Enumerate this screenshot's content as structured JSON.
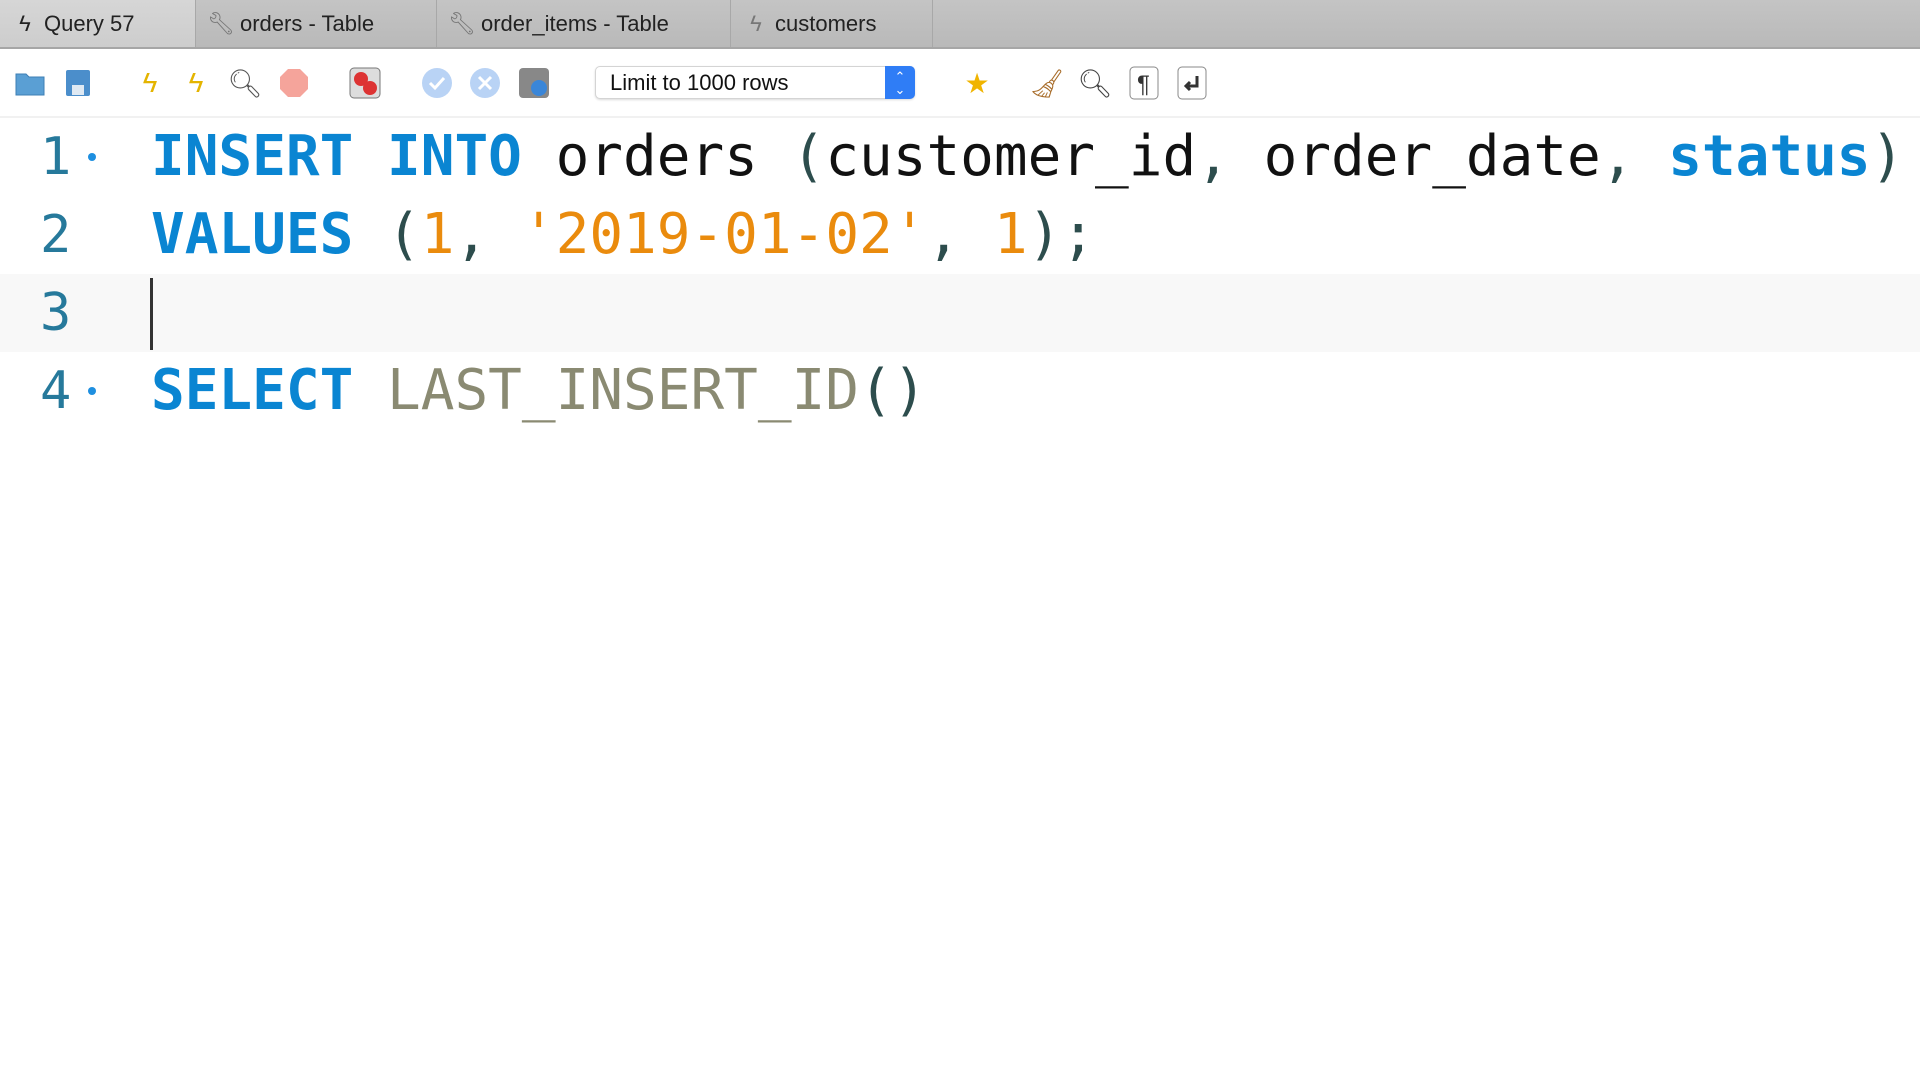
{
  "tabs": [
    {
      "label": "Query 57",
      "icon": "lightning-icon",
      "active": true
    },
    {
      "label": "orders - Table",
      "icon": "wrench-icon"
    },
    {
      "label": "order_items - Table",
      "icon": "wrench-icon"
    },
    {
      "label": "customers",
      "icon": "lightning-icon"
    }
  ],
  "toolbar": {
    "limit_select": "Limit to 1000 rows",
    "buttons": [
      "open-folder",
      "save",
      "execute",
      "execute-current",
      "explain",
      "stop",
      "toggle-error-stop",
      "commit",
      "rollback",
      "autocommit",
      "add-snippet",
      "beautify",
      "find",
      "invisible-chars",
      "word-wrap"
    ]
  },
  "editor": {
    "lines": [
      {
        "number": "1",
        "marker": true,
        "tokens": [
          {
            "t": "INSERT",
            "c": "kw"
          },
          {
            "t": " ",
            "c": "id"
          },
          {
            "t": "INTO",
            "c": "kw"
          },
          {
            "t": " orders ",
            "c": "id"
          },
          {
            "t": "(",
            "c": "pn"
          },
          {
            "t": "customer_id",
            "c": "id"
          },
          {
            "t": ", ",
            "c": "pn"
          },
          {
            "t": "order_date",
            "c": "id"
          },
          {
            "t": ", ",
            "c": "pn"
          },
          {
            "t": "status",
            "c": "kw"
          },
          {
            "t": ")",
            "c": "pn"
          }
        ]
      },
      {
        "number": "2",
        "marker": false,
        "tokens": [
          {
            "t": "VALUES",
            "c": "kw"
          },
          {
            "t": " (",
            "c": "pn"
          },
          {
            "t": "1",
            "c": "num"
          },
          {
            "t": ", ",
            "c": "pn"
          },
          {
            "t": "'2019-01-02'",
            "c": "str"
          },
          {
            "t": ", ",
            "c": "pn"
          },
          {
            "t": "1",
            "c": "num"
          },
          {
            "t": ");",
            "c": "pn"
          }
        ]
      },
      {
        "number": "3",
        "marker": false,
        "current": true,
        "tokens": []
      },
      {
        "number": "4",
        "marker": true,
        "tokens": [
          {
            "t": "SELECT",
            "c": "kw"
          },
          {
            "t": " ",
            "c": "id"
          },
          {
            "t": "LAST_INSERT_ID",
            "c": "fn"
          },
          {
            "t": "()",
            "c": "pn"
          }
        ]
      }
    ]
  }
}
